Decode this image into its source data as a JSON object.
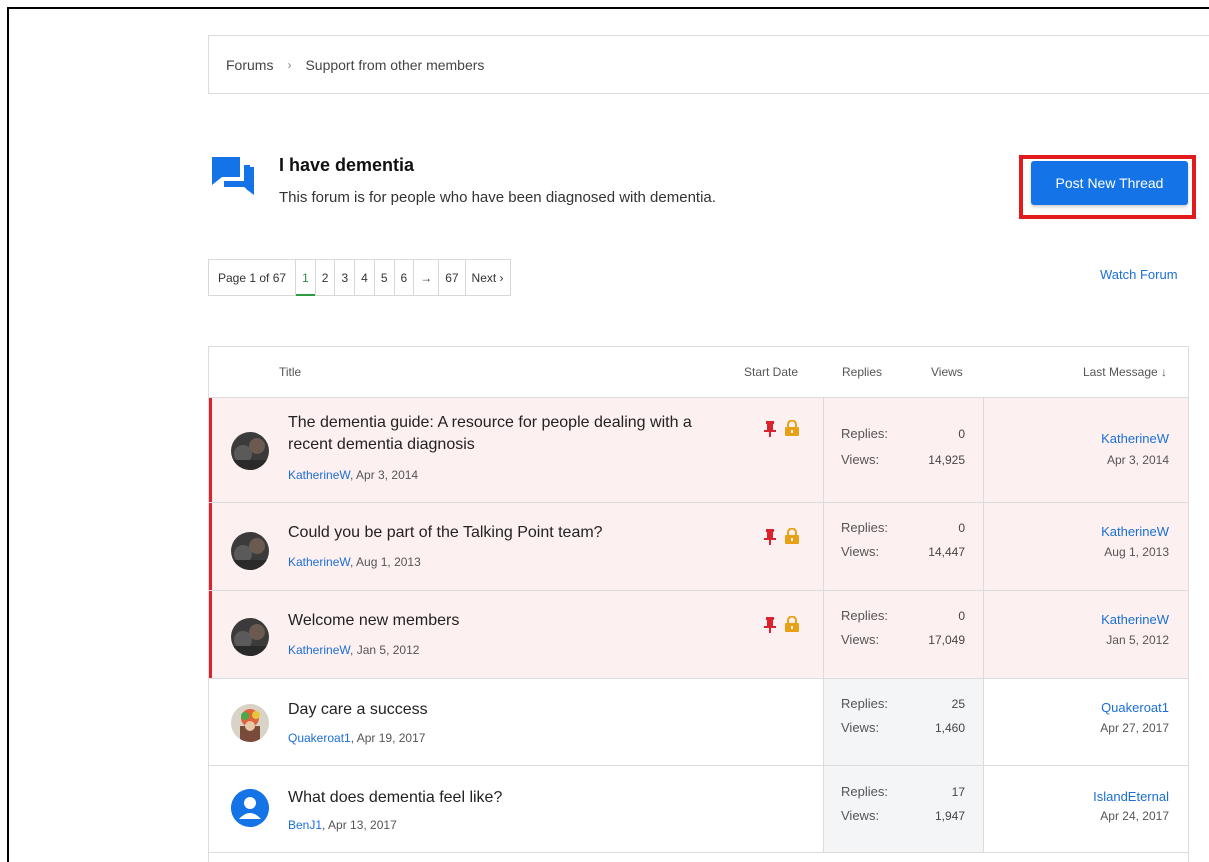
{
  "breadcrumb": {
    "root": "Forums",
    "separator": "›",
    "current": "Support from other members"
  },
  "forum": {
    "title": "I have dementia",
    "description": "This forum is for people who have been diagnosed with dementia.",
    "icon": "chat-bubbles-icon",
    "post_button": "Post New Thread",
    "watch": "Watch Forum"
  },
  "pager": {
    "label": "Page 1 of 67",
    "pages": [
      "1",
      "2",
      "3",
      "4",
      "5",
      "6"
    ],
    "jump": "→",
    "last": "67",
    "next": "Next ›"
  },
  "table": {
    "headers": {
      "title": "Title",
      "start_date": "Start Date",
      "replies": "Replies",
      "views": "Views",
      "last_message": "Last Message ↓"
    }
  },
  "threads": [
    {
      "title_line1": "The dementia guide: A resource for people dealing with a",
      "title_line2": "recent dementia diagnosis",
      "author": "KatherineW",
      "date": ", Apr 3, 2014",
      "replies_label": "Replies:",
      "replies": "0",
      "views_label": "Views:",
      "views": "14,925",
      "last_user": "KatherineW",
      "last_date": "Apr 3, 2014",
      "sticky": true,
      "locked": true
    },
    {
      "title_line1": "Could you be part of the Talking Point team?",
      "author": "KatherineW",
      "date": ", Aug 1, 2013",
      "replies_label": "Replies:",
      "replies": "0",
      "views_label": "Views:",
      "views": "14,447",
      "last_user": "KatherineW",
      "last_date": "Aug 1, 2013",
      "sticky": true,
      "locked": true
    },
    {
      "title_line1": "Welcome new members",
      "author": "KatherineW",
      "date": ", Jan 5, 2012",
      "replies_label": "Replies:",
      "replies": "0",
      "views_label": "Views:",
      "views": "17,049",
      "last_user": "KatherineW",
      "last_date": "Jan 5, 2012",
      "sticky": true,
      "locked": true
    },
    {
      "title_line1": "Day care a success",
      "author": "Quakeroat1",
      "date": ", Apr 19, 2017",
      "replies_label": "Replies:",
      "replies": "25",
      "views_label": "Views:",
      "views": "1,460",
      "last_user": "Quakeroat1",
      "last_date": "Apr 27, 2017",
      "sticky": false,
      "locked": false
    },
    {
      "title_line1": "What does dementia feel like?",
      "author": "BenJ1",
      "date": ", Apr 13, 2017",
      "replies_label": "Replies:",
      "replies": "17",
      "views_label": "Views:",
      "views": "1,947",
      "last_user": "IslandEternal",
      "last_date": "Apr 24, 2017",
      "sticky": false,
      "locked": false
    }
  ],
  "colors": {
    "accent": "#1473e6",
    "link": "#1a6fd6",
    "sticky_bg": "#fdf0f0",
    "sticky_bar": "#d9232d",
    "highlight_frame": "#e11b1b",
    "pin": "#d9232d",
    "lock": "#e6a117"
  }
}
